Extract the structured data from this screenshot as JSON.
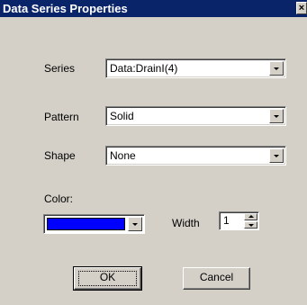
{
  "window": {
    "title": "Data Series Properties",
    "close_glyph": "×"
  },
  "form": {
    "series_label": "Series",
    "series_value": "Data:DrainI(4)",
    "pattern_label": "Pattern",
    "pattern_value": "Solid",
    "shape_label": "Shape",
    "shape_value": "None",
    "color_label": "Color:",
    "color_value": "#0000ff",
    "width_label": "Width",
    "width_value": "1"
  },
  "buttons": {
    "ok_label": "OK",
    "cancel_label": "Cancel"
  },
  "icons": {
    "close": "close-icon",
    "dropdown": "chevron-down-icon",
    "spin_up": "spin-up-icon",
    "spin_down": "spin-down-icon"
  },
  "colors": {
    "titlebar": "#0a246a",
    "dialog_bg": "#d4d0c8"
  }
}
